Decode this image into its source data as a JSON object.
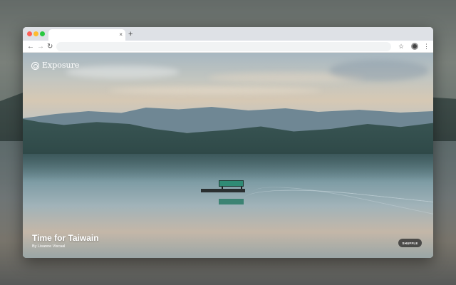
{
  "browser": {
    "tab": {
      "title": "",
      "close_glyph": "×"
    },
    "new_tab_glyph": "+",
    "toolbar": {
      "back_glyph": "←",
      "forward_glyph": "→",
      "reload_glyph": "↻",
      "address": "",
      "star_glyph": "☆",
      "menu_glyph": "⋮"
    }
  },
  "page": {
    "brand": {
      "name": "Exposure",
      "icon": "exposure-logo-icon"
    },
    "photo": {
      "title": "Time for Taiwain",
      "credit": "By Lisanne Viscaal"
    },
    "shuffle_label": "SHUFFLE"
  },
  "colors": {
    "accent_boat": "#2f8b75",
    "traffic_red": "#fe5f57",
    "traffic_yellow": "#febc2e",
    "traffic_green": "#28c840"
  }
}
